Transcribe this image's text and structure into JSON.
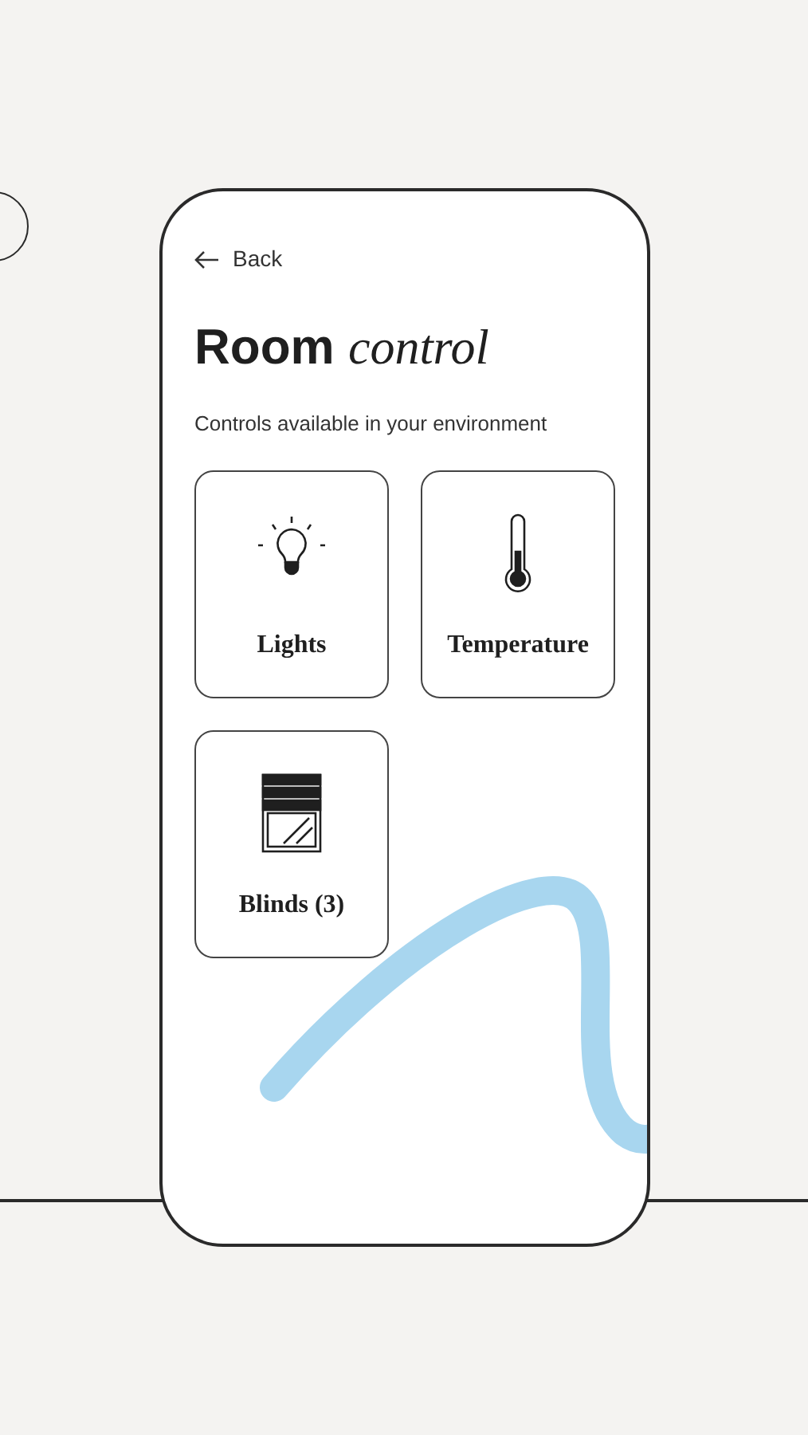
{
  "back": {
    "label": "Back"
  },
  "title": "Room *control*",
  "subtitle": "Controls available in your environment",
  "controls": [
    {
      "kind": "lights",
      "label": "Lights"
    },
    {
      "kind": "temperature",
      "label": "Temperature"
    },
    {
      "kind": "blinds",
      "label": "Blinds (3)"
    }
  ]
}
